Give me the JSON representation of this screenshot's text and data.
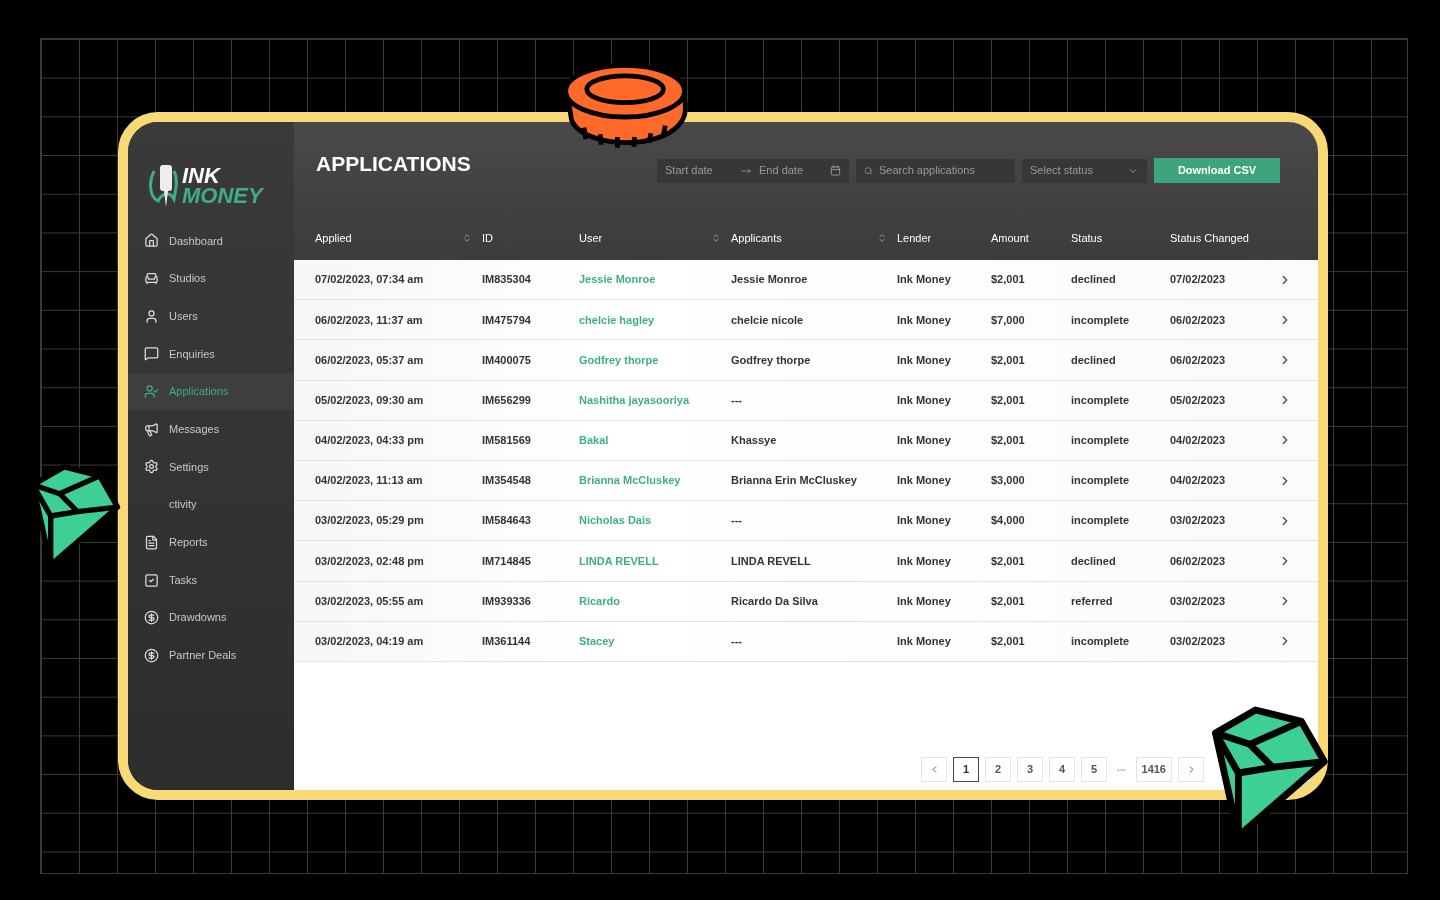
{
  "logo": {
    "line1": "INK",
    "line2": "MONEY"
  },
  "sidebar": {
    "items": [
      {
        "label": "Dashboard",
        "selected": false
      },
      {
        "label": "Studios",
        "selected": false
      },
      {
        "label": "Users",
        "selected": false
      },
      {
        "label": "Enquiries",
        "selected": false
      },
      {
        "label": "Applications",
        "selected": true
      },
      {
        "label": "Messages",
        "selected": false
      },
      {
        "label": "Settings",
        "selected": false
      },
      {
        "label": "ctivity",
        "selected": false
      },
      {
        "label": "Reports",
        "selected": false
      },
      {
        "label": "Tasks",
        "selected": false
      },
      {
        "label": "Drawdowns",
        "selected": false
      },
      {
        "label": "Partner Deals",
        "selected": false
      }
    ]
  },
  "title": "APPLICATIONS",
  "filters": {
    "start_date": {
      "placeholder": "Start date"
    },
    "end_date": {
      "placeholder": "End date"
    },
    "search": {
      "placeholder": "Search applications"
    },
    "status": {
      "placeholder": "Select status"
    },
    "download": "Download CSV"
  },
  "table": {
    "columns": [
      {
        "label": "Applied",
        "sortable": true
      },
      {
        "label": "ID",
        "sortable": false
      },
      {
        "label": "User",
        "sortable": true
      },
      {
        "label": "Applicants",
        "sortable": true
      },
      {
        "label": "Lender",
        "sortable": false
      },
      {
        "label": "Amount",
        "sortable": false
      },
      {
        "label": "Status",
        "sortable": false
      },
      {
        "label": "Status Changed",
        "sortable": false
      }
    ],
    "rows": [
      {
        "applied": "07/02/2023, 07:34 am",
        "id": "IM835304",
        "user": "Jessie Monroe",
        "applicants": "Jessie Monroe",
        "lender": "Ink Money",
        "amount": "$2,001",
        "status": "declined",
        "status_changed": "07/02/2023"
      },
      {
        "applied": "06/02/2023, 11:37 am",
        "id": "IM475794",
        "user": "chelcie hagley",
        "applicants": "chelcie nicole",
        "lender": "Ink Money",
        "amount": "$7,000",
        "status": "incomplete",
        "status_changed": "06/02/2023"
      },
      {
        "applied": "06/02/2023, 05:37 am",
        "id": "IM400075",
        "user": "Godfrey thorpe",
        "applicants": "Godfrey thorpe",
        "lender": "Ink Money",
        "amount": "$2,001",
        "status": "declined",
        "status_changed": "06/02/2023"
      },
      {
        "applied": "05/02/2023, 09:30 am",
        "id": "IM656299",
        "user": "Nashitha jayasooriya",
        "applicants": "---",
        "lender": "Ink Money",
        "amount": "$2,001",
        "status": "incomplete",
        "status_changed": "05/02/2023"
      },
      {
        "applied": "04/02/2023, 04:33 pm",
        "id": "IM581569",
        "user": "Bakal",
        "applicants": "Khassye",
        "lender": "Ink Money",
        "amount": "$2,001",
        "status": "incomplete",
        "status_changed": "04/02/2023"
      },
      {
        "applied": "04/02/2023, 11:13 am",
        "id": "IM354548",
        "user": "Brianna McCluskey",
        "applicants": "Brianna Erin McCluskey",
        "lender": "Ink Money",
        "amount": "$3,000",
        "status": "incomplete",
        "status_changed": "04/02/2023"
      },
      {
        "applied": "03/02/2023, 05:29 pm",
        "id": "IM584643",
        "user": "Nicholas Dais",
        "applicants": "---",
        "lender": "Ink Money",
        "amount": "$4,000",
        "status": "incomplete",
        "status_changed": "03/02/2023"
      },
      {
        "applied": "03/02/2023, 02:48 pm",
        "id": "IM714845",
        "user": "LINDA REVELL",
        "applicants": "LINDA REVELL",
        "lender": "Ink Money",
        "amount": "$2,001",
        "status": "declined",
        "status_changed": "06/02/2023"
      },
      {
        "applied": "03/02/2023, 05:55 am",
        "id": "IM939336",
        "user": "Ricardo",
        "applicants": "Ricardo Da Silva",
        "lender": "Ink Money",
        "amount": "$2,001",
        "status": "referred",
        "status_changed": "03/02/2023"
      },
      {
        "applied": "03/02/2023, 04:19 am",
        "id": "IM361144",
        "user": "Stacey",
        "applicants": "---",
        "lender": "Ink Money",
        "amount": "$2,001",
        "status": "incomplete",
        "status_changed": "03/02/2023"
      }
    ]
  },
  "pagination": {
    "pages": [
      {
        "label": "1",
        "selected": true
      },
      {
        "label": "2",
        "selected": false
      },
      {
        "label": "3",
        "selected": false
      },
      {
        "label": "4",
        "selected": false
      },
      {
        "label": "5",
        "selected": false
      }
    ],
    "ellipsis": "•••",
    "last": {
      "label": "1416",
      "selected": false
    }
  }
}
